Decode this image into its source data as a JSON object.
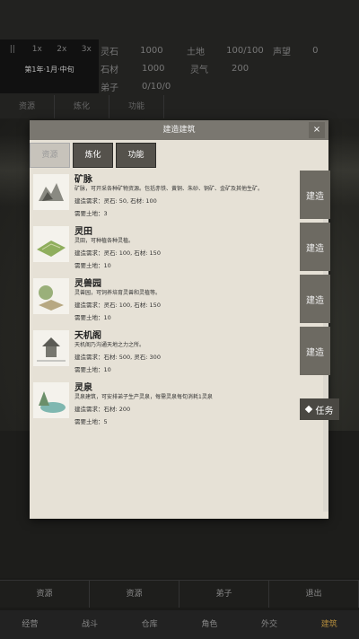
{
  "top": {
    "speeds": [
      "||",
      "1x",
      "2x",
      "3x"
    ],
    "date": "第1年·1月·中旬",
    "stats": [
      [
        {
          "k": "灵石",
          "v": "1000"
        },
        {
          "k": "土地",
          "v": "100/100"
        },
        {
          "k": "声望",
          "v": "0"
        }
      ],
      [
        {
          "k": "石材",
          "v": "1000"
        },
        {
          "k": "灵气",
          "v": "200"
        }
      ],
      [
        {
          "k": "弟子",
          "v": "0/10/0"
        }
      ]
    ],
    "tabs": [
      "资源",
      "炼化",
      "功能"
    ]
  },
  "modal": {
    "title": "建造建筑",
    "close": "×",
    "tabs": [
      "资源",
      "炼化",
      "功能"
    ],
    "items": [
      {
        "name": "矿脉",
        "desc": "矿脉，可开采各种矿物资源。包括赤铁、黄铜、朱砂、铜矿、金矿及其他生矿。",
        "req": "建造需求：灵石: 50, 石材: 100",
        "land": "需要土地：3"
      },
      {
        "name": "灵田",
        "desc": "灵田，可种植各种灵植。",
        "req": "建造需求：灵石: 100, 石材: 150",
        "land": "需要土地：10"
      },
      {
        "name": "灵兽园",
        "desc": "灵兽园，可饲养培育灵兽和灵植等。",
        "req": "建造需求：灵石: 100, 石材: 150",
        "land": "需要土地：10"
      },
      {
        "name": "天机阁",
        "desc": "天机阁乃沟通天地之力之所。",
        "req": "建造需求：石材: 500, 灵石: 300",
        "land": "需要土地：10"
      },
      {
        "name": "灵泉",
        "desc": "灵泉建筑，可安排弟子生产灵泉，每需灵泉每旬消耗1灵泉",
        "req": "建造需求：石材: 200",
        "land": "需要土地：5"
      }
    ]
  },
  "side": {
    "build": [
      "建造",
      "建造",
      "建造",
      "建造"
    ],
    "task": "任务"
  },
  "bottom": {
    "row1": [
      "资源",
      "资源",
      "弟子",
      "退出"
    ],
    "row2": [
      "经营",
      "战斗",
      "仓库",
      "角色",
      "外交",
      "建筑"
    ]
  }
}
